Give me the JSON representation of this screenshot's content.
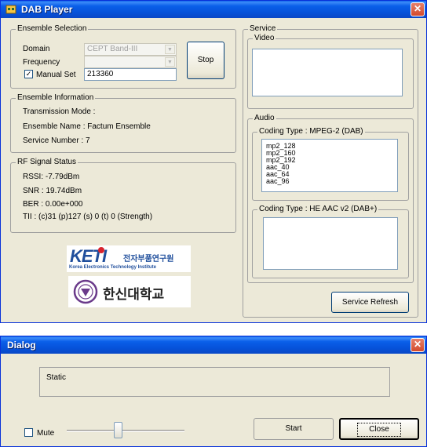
{
  "dab": {
    "title": "DAB Player",
    "ensemble_selection": {
      "legend": "Ensemble Selection",
      "domain_label": "Domain",
      "domain_value": "CEPT Band-III",
      "frequency_label": "Frequency",
      "frequency_value": "",
      "manual_set_label": "Manual Set",
      "manual_set_checked": true,
      "manual_value": "213360",
      "stop_label": "Stop"
    },
    "ensemble_info": {
      "legend": "Ensemble Information",
      "transmission_mode": "Transmission Mode :",
      "ensemble_name": "Ensemble Name : Factum Ensemble",
      "service_number": "Service Number : 7"
    },
    "rf_status": {
      "legend": "RF Signal Status",
      "rssi": "RSSI: -7.79dBm",
      "snr": "SNR : 19.74dBm",
      "ber": "BER : 0.00e+000",
      "tii": "TII : (c)31 (p)127 (s) 0 (t) 0 (Strength)"
    },
    "logos": {
      "keti_mark": "KETI",
      "keti_korean": "전자부품연구원",
      "keti_english": "Korea Electronics Technology Institute",
      "hanshin": "한신대학교"
    },
    "service": {
      "legend": "Service",
      "video_legend": "Video",
      "audio_legend": "Audio",
      "coding_mpeg_legend": "Coding Type : MPEG-2 (DAB)",
      "mpeg_items": [
        "mp2_128",
        "mp2_160",
        "mp2_192",
        "aac_40",
        "aac_64",
        "aac_96"
      ],
      "coding_heaac_legend": "Coding Type : HE AAC v2 (DAB+)",
      "refresh_label": "Service Refresh"
    }
  },
  "dialog": {
    "title": "Dialog",
    "static_text": "Static",
    "mute_label": "Mute",
    "mute_checked": false,
    "slider_level": 0.43,
    "start_label": "Start",
    "close_label": "Close"
  },
  "colors": {
    "titlebar": "#0a5fe9",
    "face": "#ece9d8",
    "keti_blue": "#1f4e9c",
    "keti_red": "#d9232d"
  }
}
